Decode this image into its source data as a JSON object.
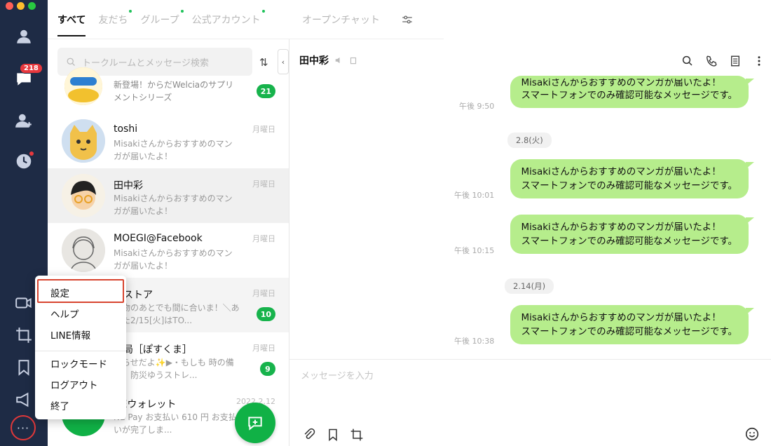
{
  "rail": {
    "chat_badge": "218"
  },
  "tabs": [
    {
      "label": "すべて"
    },
    {
      "label": "友だち"
    },
    {
      "label": "グループ"
    },
    {
      "label": "公式アカウント"
    },
    {
      "label": "オープンチャット"
    }
  ],
  "search": {
    "placeholder": "トークルームとメッセージ検索"
  },
  "chats": [
    {
      "name": "",
      "preview": "新登場！からだWelciaのサプリメントシリーズ",
      "date": "",
      "badge": "21"
    },
    {
      "name": "toshi",
      "preview": "Misakiさんからおすすめのマンガが届いたよ！",
      "date": "月曜日",
      "badge": ""
    },
    {
      "name": "田中彩",
      "preview": "Misakiさんからおすすめのマンガが届いたよ！",
      "date": "月曜日",
      "badge": ""
    },
    {
      "name": "MOEGI@Facebook",
      "preview": "Misakiさんからおすすめのマンガが届いたよ！",
      "date": "月曜日",
      "badge": ""
    },
    {
      "name": "急ストア",
      "preview": "買物のあとでも間に合いま！＼あした2/15[火]はTO...",
      "date": "月曜日",
      "badge": "10"
    },
    {
      "name": "更局［ぽすくま］",
      "preview": "知らせだよ✨▶・もしも 時の備え、防災ゆうストレ...",
      "date": "月曜日",
      "badge": "9"
    },
    {
      "name": "NEウォレット",
      "preview": "NE Pay お支払い 610 円 お支払いが完了しま...",
      "date": "2022.2.12",
      "badge": ""
    }
  ],
  "menu": {
    "items": [
      "設定",
      "ヘルプ",
      "LINE情報",
      "ロックモード",
      "ログアウト",
      "終了"
    ]
  },
  "chat": {
    "title": "田中彩",
    "messages": [
      {
        "line1": "Misakiさんからおすすめのマンガが届いたよ！",
        "line2": "スマートフォンでのみ確認可能なメッセージです。",
        "time": "午後 9:50"
      },
      {
        "line1": "Misakiさんからおすすめのマンガが届いたよ！",
        "line2": "スマートフォンでのみ確認可能なメッセージです。",
        "time": "午後 10:01"
      },
      {
        "line1": "Misakiさんからおすすめのマンガが届いたよ！",
        "line2": "スマートフォンでのみ確認可能なメッセージです。",
        "time": "午後 10:15"
      },
      {
        "line1": "Misakiさんからおすすめのマンガが届いたよ！",
        "line2": "スマートフォンでのみ確認可能なメッセージです。",
        "time": "午後 10:38"
      }
    ],
    "date_chips": [
      "2.8(火)",
      "2.14(月)"
    ],
    "input_placeholder": "メッセージを入力"
  },
  "colors": {
    "rail_bg": "#1e2b45",
    "accent_green": "#10b146",
    "bubble_green": "#b6ed8c",
    "highlight_red": "#d8442f",
    "badge_red": "#e8383d"
  }
}
